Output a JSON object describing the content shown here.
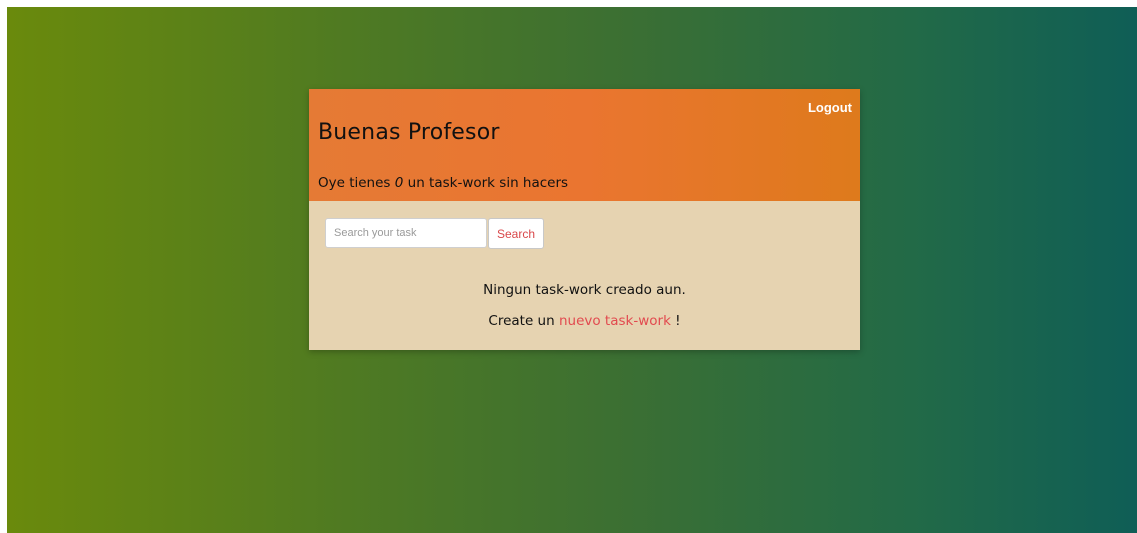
{
  "header": {
    "logout_label": "Logout",
    "greeting": "Buenas Profesor",
    "pending_prefix": "Oye tienes ",
    "pending_count": "0",
    "pending_suffix": " un task-work sin hacers"
  },
  "search": {
    "placeholder": "Search your task",
    "value": "",
    "button_label": "Search"
  },
  "empty_state": {
    "message": "Ningun task-work creado aun.",
    "create_prefix": "Create un ",
    "create_link": "nuevo task-work",
    "create_suffix": " !"
  },
  "colors": {
    "header_bg": "#e87530",
    "body_bg": "#e6d3b1",
    "link": "#e24a4f",
    "page_gradient_start": "#6a8a0c",
    "page_gradient_end": "#0f5e56"
  }
}
